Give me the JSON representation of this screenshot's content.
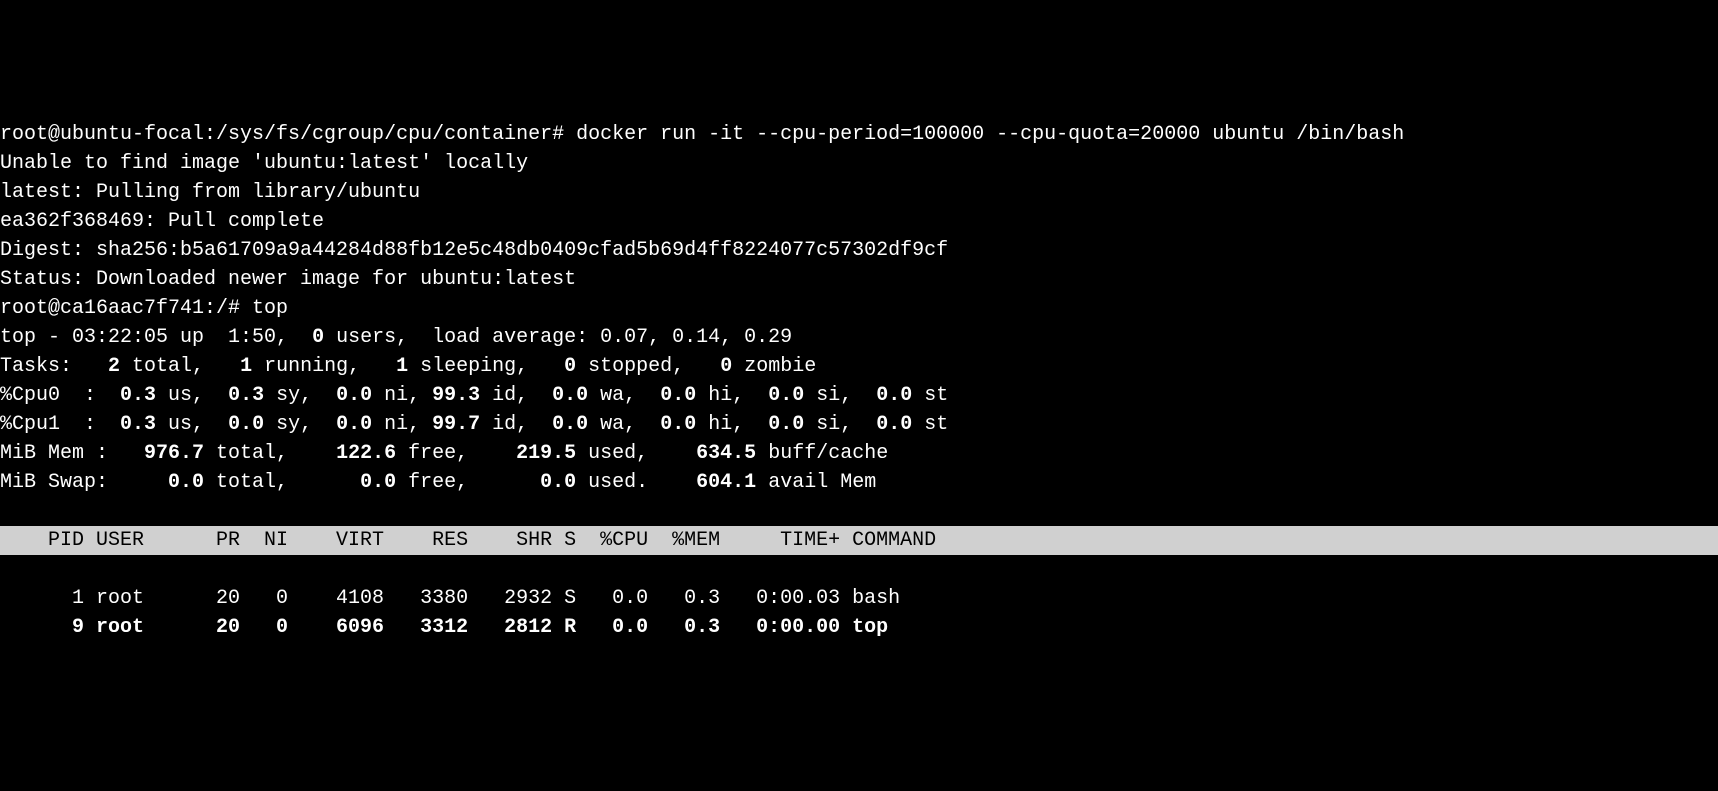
{
  "prompt1": {
    "user_host_path": "root@ubuntu-focal:/sys/fs/cgroup/cpu/container# ",
    "command": "docker run -it --cpu-period=100000 --cpu-quota=20000 ubuntu /bin/bash"
  },
  "docker_output": {
    "line1": "Unable to find image 'ubuntu:latest' locally",
    "line2": "latest: Pulling from library/ubuntu",
    "line3": "ea362f368469: Pull complete",
    "line4": "Digest: sha256:b5a61709a9a44284d88fb12e5c48db0409cfad5b69d4ff8224077c57302df9cf",
    "line5": "Status: Downloaded newer image for ubuntu:latest"
  },
  "prompt2": {
    "user_host_path": "root@ca16aac7f741:/# ",
    "command": "top"
  },
  "top": {
    "summary": {
      "line1_prefix": "top - 03:22:05 up  1:50,  ",
      "line1_users_bold": "0",
      "line1_users_suffix": " users,  load average: 0.07, 0.14, 0.29",
      "tasks_label": "Tasks: ",
      "tasks_total_bold": "  2",
      "tasks_total_suffix": " total,   ",
      "tasks_running_bold": "1",
      "tasks_running_suffix": " running,   ",
      "tasks_sleeping_bold": "1",
      "tasks_sleeping_suffix": " sleeping,   ",
      "tasks_stopped_bold": "0",
      "tasks_stopped_suffix": " stopped,   ",
      "tasks_zombie_bold": "0",
      "tasks_zombie_suffix": " zombie",
      "cpu0_label": "%Cpu0  :  ",
      "cpu0_us_bold": "0.3",
      "cpu0_us_suffix": " us,  ",
      "cpu0_sy_bold": "0.3",
      "cpu0_sy_suffix": " sy,  ",
      "cpu0_ni_bold": "0.0",
      "cpu0_ni_suffix": " ni, ",
      "cpu0_id_bold": "99.3",
      "cpu0_id_suffix": " id,  ",
      "cpu0_wa_bold": "0.0",
      "cpu0_wa_suffix": " wa,  ",
      "cpu0_hi_bold": "0.0",
      "cpu0_hi_suffix": " hi,  ",
      "cpu0_si_bold": "0.0",
      "cpu0_si_suffix": " si,  ",
      "cpu0_st_bold": "0.0",
      "cpu0_st_suffix": " st",
      "cpu1_label": "%Cpu1  :  ",
      "cpu1_us_bold": "0.3",
      "cpu1_us_suffix": " us,  ",
      "cpu1_sy_bold": "0.0",
      "cpu1_sy_suffix": " sy,  ",
      "cpu1_ni_bold": "0.0",
      "cpu1_ni_suffix": " ni, ",
      "cpu1_id_bold": "99.7",
      "cpu1_id_suffix": " id,  ",
      "cpu1_wa_bold": "0.0",
      "cpu1_wa_suffix": " wa,  ",
      "cpu1_hi_bold": "0.0",
      "cpu1_hi_suffix": " hi,  ",
      "cpu1_si_bold": "0.0",
      "cpu1_si_suffix": " si,  ",
      "cpu1_st_bold": "0.0",
      "cpu1_st_suffix": " st",
      "mem_label": "MiB Mem :   ",
      "mem_total_bold": "976.7",
      "mem_total_suffix": " total,    ",
      "mem_free_bold": "122.6",
      "mem_free_suffix": " free,    ",
      "mem_used_bold": "219.5",
      "mem_used_suffix": " used,    ",
      "mem_cache_bold": "634.5",
      "mem_cache_suffix": " buff/cache",
      "swap_label": "MiB Swap:     ",
      "swap_total_bold": "0.0",
      "swap_total_suffix": " total,      ",
      "swap_free_bold": "0.0",
      "swap_free_suffix": " free,      ",
      "swap_used_bold": "0.0",
      "swap_used_suffix": " used.    ",
      "swap_avail_bold": "604.1",
      "swap_avail_suffix": " avail Mem"
    },
    "header": "    PID USER      PR  NI    VIRT    RES    SHR S  %CPU  %MEM     TIME+ COMMAND",
    "processes": [
      {
        "row": "      1 root      20   0    4108   3380   2932 S   0.0   0.3   0:00.03 bash",
        "bold": false
      },
      {
        "row": "      9 root      20   0    6096   3312   2812 R   0.0   0.3   0:00.00 top",
        "bold": true
      }
    ]
  }
}
